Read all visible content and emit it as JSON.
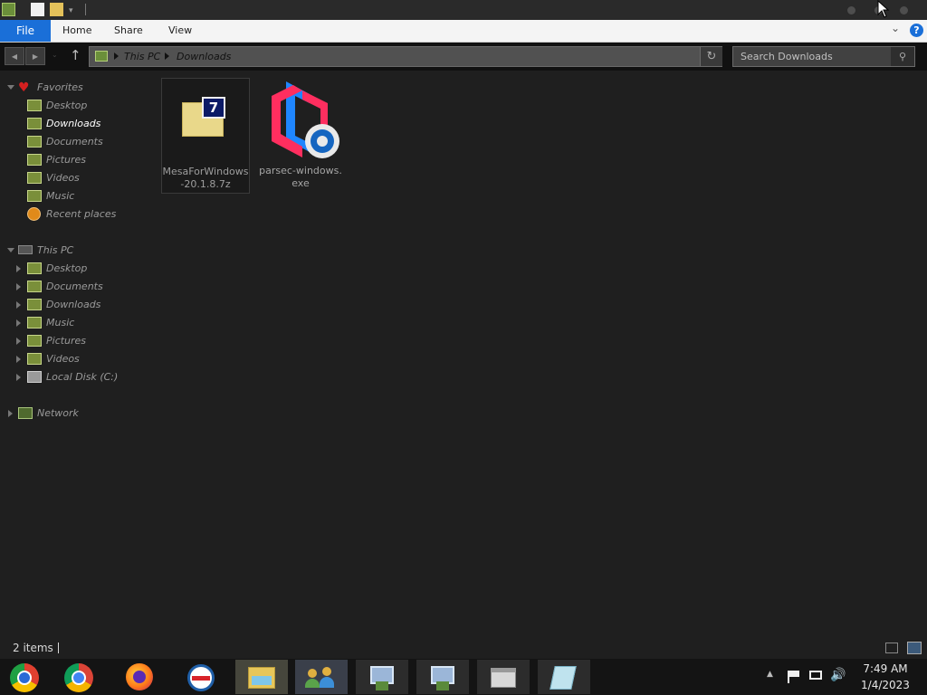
{
  "ribbon": {
    "file_label": "File",
    "tabs": [
      "Home",
      "Share",
      "View"
    ]
  },
  "address": {
    "crumbs": [
      "This PC",
      "Downloads"
    ]
  },
  "search": {
    "placeholder": "Search Downloads"
  },
  "nav": {
    "favorites": {
      "label": "Favorites",
      "items": [
        "Desktop",
        "Downloads",
        "Documents",
        "Pictures",
        "Videos",
        "Music",
        "Recent places"
      ]
    },
    "this_pc": {
      "label": "This PC",
      "items": [
        "Desktop",
        "Documents",
        "Downloads",
        "Music",
        "Pictures",
        "Videos",
        "Local Disk (C:)"
      ]
    },
    "network": {
      "label": "Network"
    }
  },
  "files": [
    {
      "name": "MesaForWindows-20.1.8.7z",
      "badge": "7"
    },
    {
      "name": "parsec-windows.exe"
    }
  ],
  "status": {
    "count": "2 items"
  },
  "clock": {
    "time": "7:49 AM",
    "date": "1/4/2023"
  },
  "taskbar": {
    "apps": [
      "chrome-canary-icon",
      "chrome-icon",
      "firefox-icon",
      "obama-campaign-icon",
      "file-explorer-icon",
      "users-network-icon",
      "installer-icon",
      "installer-icon",
      "archive-icon",
      "notepad-icon"
    ]
  },
  "colors": {
    "accent": "#1a6fd8",
    "background": "#1f1f1f"
  }
}
